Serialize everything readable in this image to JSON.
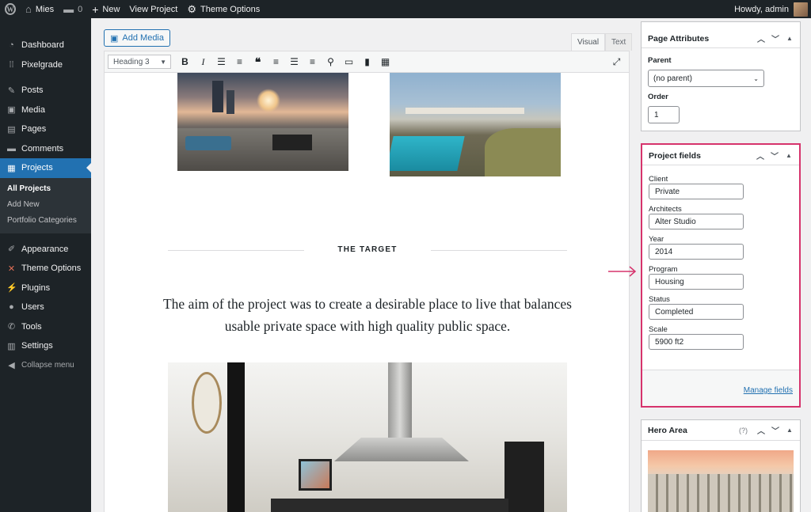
{
  "adminbar": {
    "site_name": "Mies",
    "comments_count": "0",
    "new_label": "New",
    "view_label": "View Project",
    "theme_options_label": "Theme Options",
    "greeting": "Howdy, admin"
  },
  "sidebar": {
    "items": [
      {
        "label": "Dashboard",
        "icon": "dashboard-icon"
      },
      {
        "label": "Pixelgrade",
        "icon": "pixelgrade-icon"
      },
      {
        "label": "Posts",
        "icon": "pin-icon"
      },
      {
        "label": "Media",
        "icon": "media-icon"
      },
      {
        "label": "Pages",
        "icon": "pages-icon"
      },
      {
        "label": "Comments",
        "icon": "comment-icon"
      },
      {
        "label": "Projects",
        "icon": "projects-icon"
      },
      {
        "label": "Appearance",
        "icon": "brush-icon"
      },
      {
        "label": "Theme Options",
        "icon": "theme-options-icon"
      },
      {
        "label": "Plugins",
        "icon": "plugin-icon"
      },
      {
        "label": "Users",
        "icon": "user-icon"
      },
      {
        "label": "Tools",
        "icon": "wrench-icon"
      },
      {
        "label": "Settings",
        "icon": "settings-icon"
      },
      {
        "label": "Collapse menu",
        "icon": "collapse-icon"
      }
    ],
    "submenu": [
      "All Projects",
      "Add New",
      "Portfolio Categories"
    ]
  },
  "editor": {
    "add_media": "Add Media",
    "tab_visual": "Visual",
    "tab_text": "Text",
    "format": "Heading 3",
    "section_title": "THE TARGET",
    "lead_text": "The aim of the project was to create a desirable place to live that balances usable private space with high quality public space."
  },
  "page_attributes": {
    "title": "Page Attributes",
    "parent_label": "Parent",
    "parent_value": "(no parent)",
    "order_label": "Order",
    "order_value": "1"
  },
  "project_fields": {
    "title": "Project fields",
    "fields": [
      {
        "label": "Client",
        "value": "Private"
      },
      {
        "label": "Architects",
        "value": "Alter Studio"
      },
      {
        "label": "Year",
        "value": "2014"
      },
      {
        "label": "Program",
        "value": "Housing"
      },
      {
        "label": "Status",
        "value": "Completed"
      },
      {
        "label": "Scale",
        "value": "5900 ft2"
      }
    ],
    "manage_link": "Manage fields"
  },
  "hero_area": {
    "title": "Hero Area",
    "help": "(?)"
  },
  "colors": {
    "admin_dark": "#1d2327",
    "accent": "#2271b1",
    "highlight": "#d6336c"
  }
}
